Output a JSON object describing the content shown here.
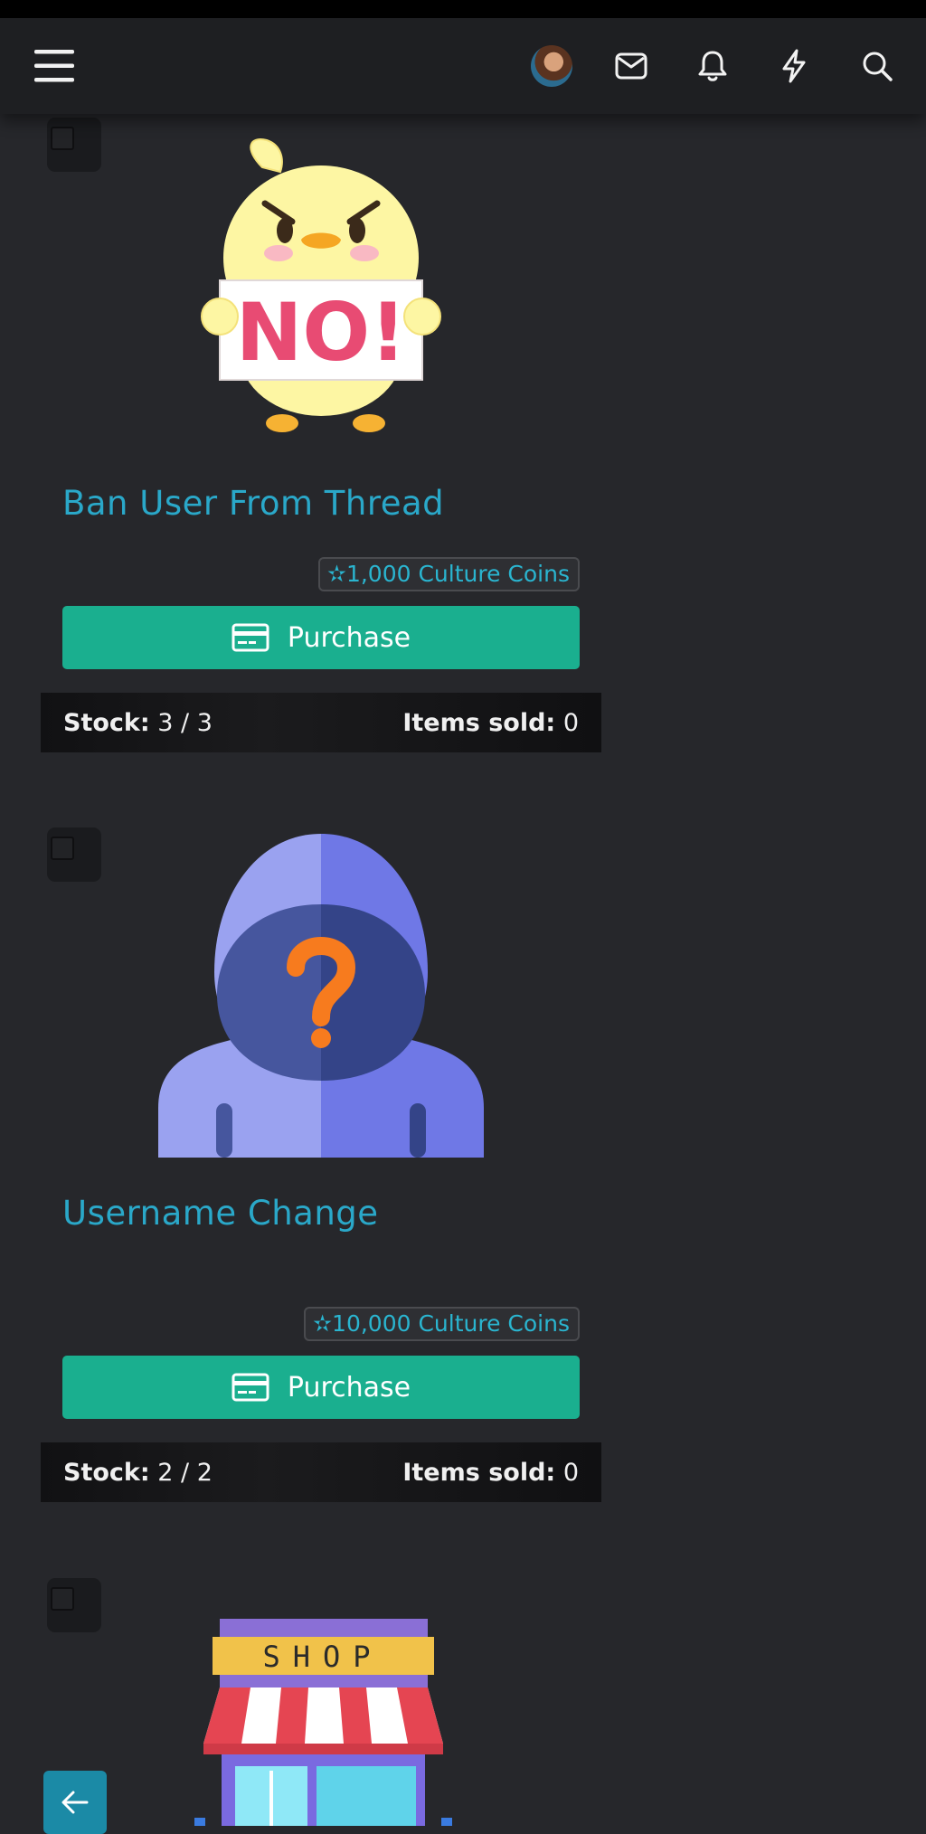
{
  "nav": {
    "menu_icon": "hamburger-icon",
    "icons": [
      "mail-icon",
      "bell-icon",
      "lightning-icon",
      "search-icon"
    ]
  },
  "items": [
    {
      "title": "Ban User From Thread",
      "price": "1,000 Culture Coins",
      "purchase_label": "Purchase",
      "stock_label": "Stock:",
      "stock_value": "3 / 3",
      "sold_label": "Items sold:",
      "sold_value": "0",
      "sign_text": "NO!"
    },
    {
      "title": "Username Change",
      "price": "10,000 Culture Coins",
      "purchase_label": "Purchase",
      "stock_label": "Stock:",
      "stock_value": "2 / 2",
      "sold_label": "Items sold:",
      "sold_value": "0"
    },
    {
      "sign_text": "SHOP"
    }
  ],
  "colors": {
    "background": "#26272b",
    "accent": "#2aa8c9",
    "purchase": "#1aaf8f"
  }
}
